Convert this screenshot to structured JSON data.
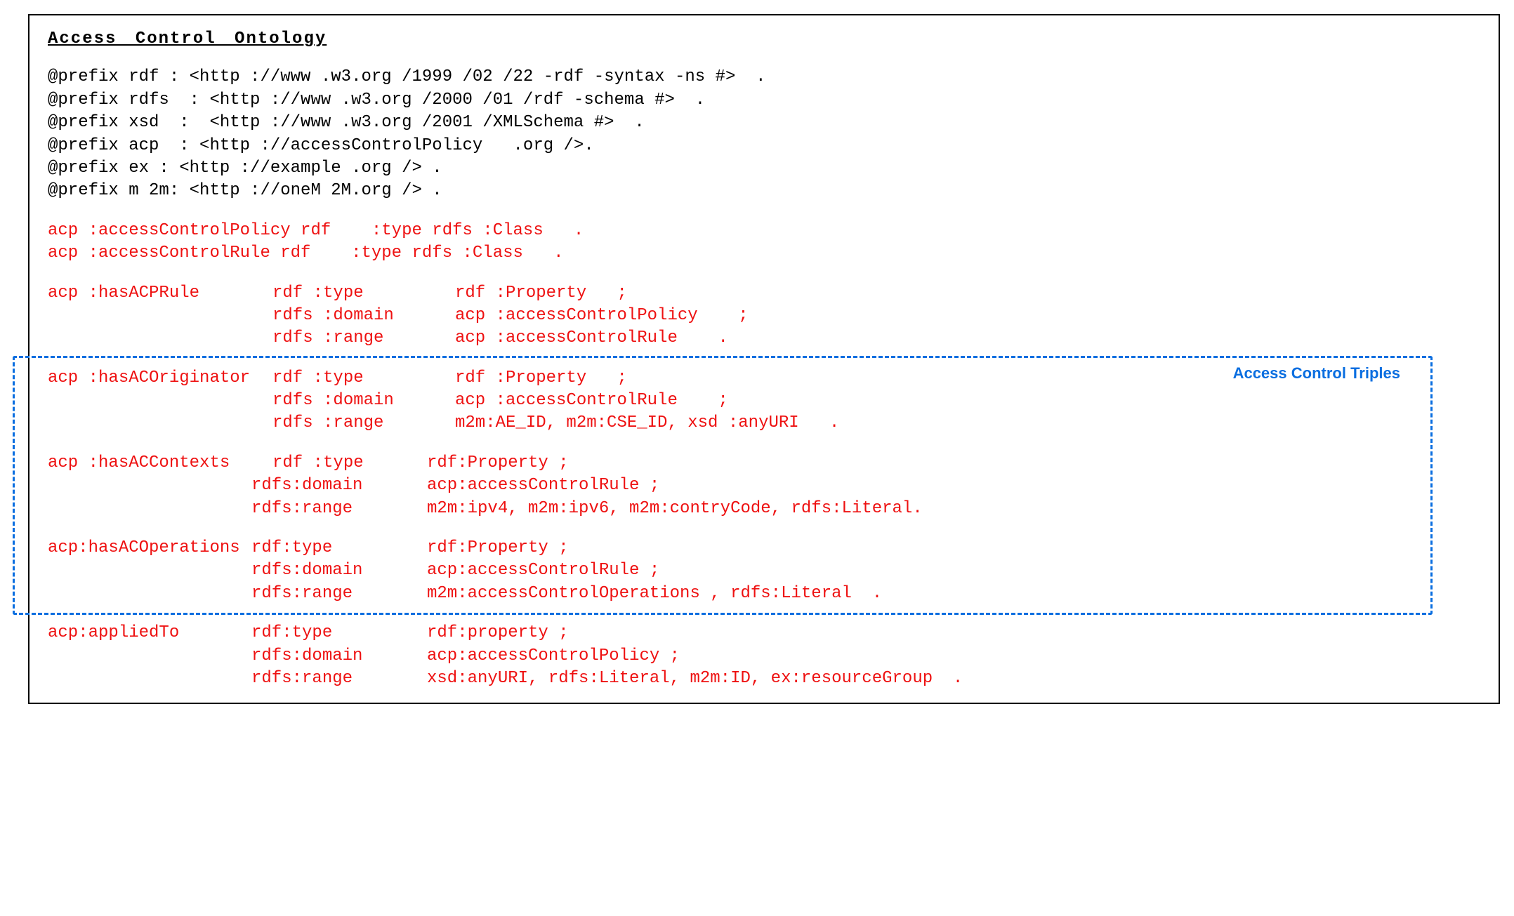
{
  "title": "Access Control Ontology",
  "prefixes": [
    "@prefix rdf : <http ://www .w3.org /1999 /02 /22 -rdf -syntax -ns #>  .",
    "@prefix rdfs  : <http ://www .w3.org /2000 /01 /rdf -schema #>  .",
    "@prefix xsd  :  <http ://www .w3.org /2001 /XMLSchema #>  .",
    "@prefix acp  : <http ://accessControlPolicy   .org />.",
    "@prefix ex : <http ://example .org /> .",
    "@prefix m 2m: <http ://oneM 2M.org /> ."
  ],
  "classdefs": [
    "acp :accessControlPolicy rdf    :type rdfs :Class   .",
    "acp :accessControlRule rdf    :type rdfs :Class   ."
  ],
  "p1": {
    "r1c1": "acp :hasACPRule",
    "r1c2": "rdf :type",
    "r1c3": "rdf :Property   ;",
    "r2c1": "",
    "r2c2": "rdfs :domain",
    "r2c3": "acp :accessControlPolicy    ;",
    "r3c1": "",
    "r3c2": "rdfs :range",
    "r3c3": "acp :accessControlRule    ."
  },
  "p2": {
    "r1c1": "acp :hasACOriginator",
    "r1c2": "rdf :type",
    "r1c3": "rdf :Property   ;",
    "r2c1": "",
    "r2c2": "rdfs :domain",
    "r2c3": "acp :accessControlRule    ;",
    "r3c1": "",
    "r3c2": "rdfs :range",
    "r3c3": "m2m:AE_ID, m2m:CSE_ID, xsd :anyURI   ."
  },
  "p3": {
    "r1c1": "acp :hasACContexts",
    "r1c2": "rdf :type",
    "r1c3": "rdf:Property ;",
    "r2c1": "",
    "r2c2": "rdfs:domain",
    "r2c3": "acp:accessControlRule ;",
    "r3c1": "",
    "r3c2": "rdfs:range",
    "r3c3": "m2m:ipv4, m2m:ipv6, m2m:contryCode, rdfs:Literal."
  },
  "p4": {
    "r1c1": "acp:hasACOperations",
    "r1c2": "rdf:type",
    "r1c3": "rdf:Property ;",
    "r2c1": "",
    "r2c2": "rdfs:domain",
    "r2c3": "acp:accessControlRule ;",
    "r3c1": "",
    "r3c2": "rdfs:range",
    "r3c3": "m2m:accessControlOperations , rdfs:Literal  ."
  },
  "p5": {
    "r1c1": "acp:appliedTo",
    "r1c2": "rdf:type",
    "r1c3": "rdf:property ;",
    "r2c1": "",
    "r2c2": "rdfs:domain",
    "r2c3": "acp:accessControlPolicy ;",
    "r3c1": "",
    "r3c2": "rdfs:range",
    "r3c3": "xsd:anyURI, rdfs:Literal, m2m:ID, ex:resourceGroup  ."
  },
  "triplesLabel": "Access Control Triples"
}
